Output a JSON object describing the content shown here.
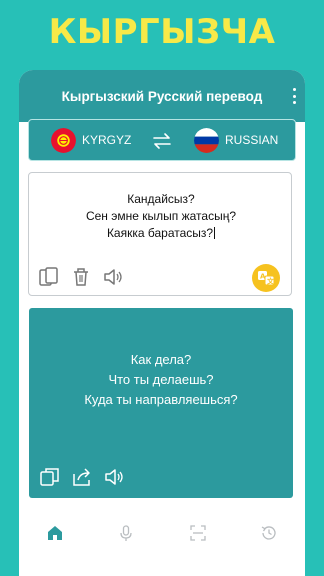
{
  "promo": {
    "title": "КЫРГЫЗЧА"
  },
  "app": {
    "title": "Кыргызский Русский перевод"
  },
  "languages": {
    "source": "KYRGYZ",
    "target": "RUSSIAN"
  },
  "input": {
    "lines": [
      "Кандайсыз?",
      "Сен эмне кылып жатасың?",
      "Каякка баратасыз?"
    ]
  },
  "output": {
    "lines": [
      "Как дела?",
      "Что ты делаешь?",
      "Куда ты направляешься?"
    ]
  },
  "colors": {
    "background": "#27c0b7",
    "accent": "#2c9a9e",
    "promo_text": "#f7e948",
    "fab": "#f6c21f"
  },
  "icons": {
    "input_actions": [
      "paste-icon",
      "delete-icon",
      "speaker-icon"
    ],
    "output_actions": [
      "copy-icon",
      "share-icon",
      "speaker-icon"
    ],
    "nav": [
      "home-icon",
      "microphone-icon",
      "scan-icon",
      "history-icon"
    ]
  }
}
